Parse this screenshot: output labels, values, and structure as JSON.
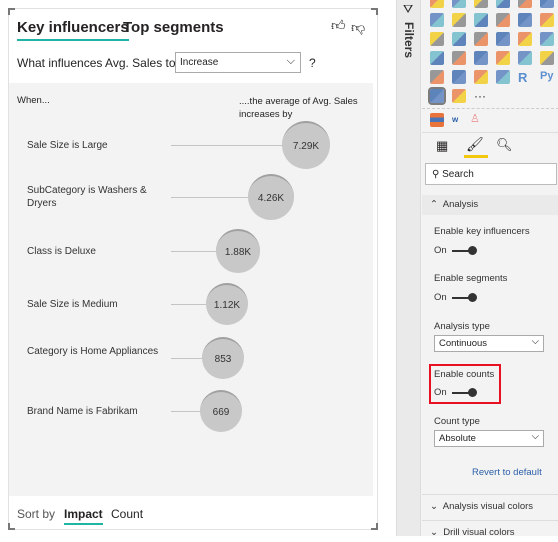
{
  "visual": {
    "tabs": [
      "Key influencers",
      "Top segments"
    ],
    "active_tab": "Key influencers",
    "accent": "#1fb4a3",
    "question": "What influences Avg. Sales to",
    "dropdown_value": "Increase",
    "help": "?",
    "col_left": "When...",
    "col_right": "....the average of Avg. Sales increases by",
    "influencers": [
      {
        "label": "Sale Size is Large",
        "value": "7.29K"
      },
      {
        "label": "SubCategory is Washers & Dryers",
        "value": "4.26K"
      },
      {
        "label": "Class is Deluxe",
        "value": "1.88K"
      },
      {
        "label": "Sale Size is Medium",
        "value": "1.12K"
      },
      {
        "label": "Category is Home Appliances",
        "value": "853"
      },
      {
        "label": "Brand Name is Fabrikam",
        "value": "669"
      }
    ],
    "sort_by": "Sort by",
    "sort_options": [
      "Impact",
      "Count"
    ],
    "active_sort": "Impact"
  },
  "pane": {
    "filters_label": "Filters",
    "search_placeholder": "Search",
    "analysis_header": "Analysis",
    "enable_key_influencers": {
      "label": "Enable key influencers",
      "state": "On"
    },
    "enable_segments": {
      "label": "Enable segments",
      "state": "On"
    },
    "analysis_type": {
      "label": "Analysis type",
      "value": "Continuous"
    },
    "enable_counts": {
      "label": "Enable counts",
      "state": "On",
      "highlight": "#e81123"
    },
    "count_type": {
      "label": "Count type",
      "value": "Absolute"
    },
    "revert": "Revert to default",
    "sections": [
      "Analysis visual colors",
      "Drill visual colors"
    ],
    "gallery_text": {
      "r": "R",
      "py": "Py",
      "more": "···"
    }
  }
}
